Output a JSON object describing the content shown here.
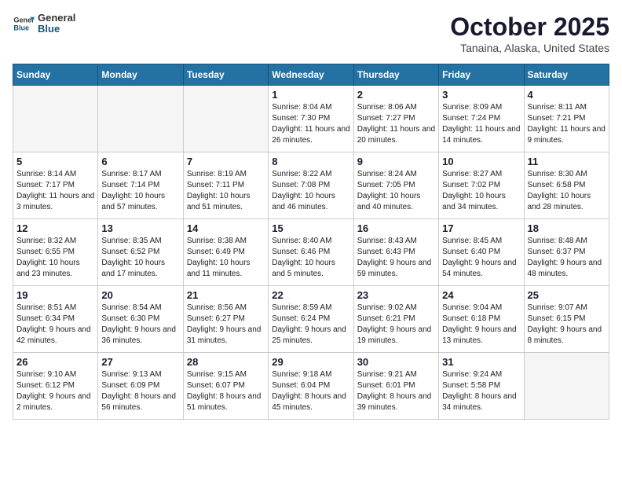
{
  "header": {
    "logo": {
      "general": "General",
      "blue": "Blue"
    },
    "title": "October 2025",
    "location": "Tanaina, Alaska, United States"
  },
  "weekdays": [
    "Sunday",
    "Monday",
    "Tuesday",
    "Wednesday",
    "Thursday",
    "Friday",
    "Saturday"
  ],
  "weeks": [
    [
      {
        "day": "",
        "empty": true
      },
      {
        "day": "",
        "empty": true
      },
      {
        "day": "",
        "empty": true
      },
      {
        "day": "1",
        "sunrise": "Sunrise: 8:04 AM",
        "sunset": "Sunset: 7:30 PM",
        "daylight": "Daylight: 11 hours and 26 minutes."
      },
      {
        "day": "2",
        "sunrise": "Sunrise: 8:06 AM",
        "sunset": "Sunset: 7:27 PM",
        "daylight": "Daylight: 11 hours and 20 minutes."
      },
      {
        "day": "3",
        "sunrise": "Sunrise: 8:09 AM",
        "sunset": "Sunset: 7:24 PM",
        "daylight": "Daylight: 11 hours and 14 minutes."
      },
      {
        "day": "4",
        "sunrise": "Sunrise: 8:11 AM",
        "sunset": "Sunset: 7:21 PM",
        "daylight": "Daylight: 11 hours and 9 minutes."
      }
    ],
    [
      {
        "day": "5",
        "sunrise": "Sunrise: 8:14 AM",
        "sunset": "Sunset: 7:17 PM",
        "daylight": "Daylight: 11 hours and 3 minutes."
      },
      {
        "day": "6",
        "sunrise": "Sunrise: 8:17 AM",
        "sunset": "Sunset: 7:14 PM",
        "daylight": "Daylight: 10 hours and 57 minutes."
      },
      {
        "day": "7",
        "sunrise": "Sunrise: 8:19 AM",
        "sunset": "Sunset: 7:11 PM",
        "daylight": "Daylight: 10 hours and 51 minutes."
      },
      {
        "day": "8",
        "sunrise": "Sunrise: 8:22 AM",
        "sunset": "Sunset: 7:08 PM",
        "daylight": "Daylight: 10 hours and 46 minutes."
      },
      {
        "day": "9",
        "sunrise": "Sunrise: 8:24 AM",
        "sunset": "Sunset: 7:05 PM",
        "daylight": "Daylight: 10 hours and 40 minutes."
      },
      {
        "day": "10",
        "sunrise": "Sunrise: 8:27 AM",
        "sunset": "Sunset: 7:02 PM",
        "daylight": "Daylight: 10 hours and 34 minutes."
      },
      {
        "day": "11",
        "sunrise": "Sunrise: 8:30 AM",
        "sunset": "Sunset: 6:58 PM",
        "daylight": "Daylight: 10 hours and 28 minutes."
      }
    ],
    [
      {
        "day": "12",
        "sunrise": "Sunrise: 8:32 AM",
        "sunset": "Sunset: 6:55 PM",
        "daylight": "Daylight: 10 hours and 23 minutes."
      },
      {
        "day": "13",
        "sunrise": "Sunrise: 8:35 AM",
        "sunset": "Sunset: 6:52 PM",
        "daylight": "Daylight: 10 hours and 17 minutes."
      },
      {
        "day": "14",
        "sunrise": "Sunrise: 8:38 AM",
        "sunset": "Sunset: 6:49 PM",
        "daylight": "Daylight: 10 hours and 11 minutes."
      },
      {
        "day": "15",
        "sunrise": "Sunrise: 8:40 AM",
        "sunset": "Sunset: 6:46 PM",
        "daylight": "Daylight: 10 hours and 5 minutes."
      },
      {
        "day": "16",
        "sunrise": "Sunrise: 8:43 AM",
        "sunset": "Sunset: 6:43 PM",
        "daylight": "Daylight: 9 hours and 59 minutes."
      },
      {
        "day": "17",
        "sunrise": "Sunrise: 8:45 AM",
        "sunset": "Sunset: 6:40 PM",
        "daylight": "Daylight: 9 hours and 54 minutes."
      },
      {
        "day": "18",
        "sunrise": "Sunrise: 8:48 AM",
        "sunset": "Sunset: 6:37 PM",
        "daylight": "Daylight: 9 hours and 48 minutes."
      }
    ],
    [
      {
        "day": "19",
        "sunrise": "Sunrise: 8:51 AM",
        "sunset": "Sunset: 6:34 PM",
        "daylight": "Daylight: 9 hours and 42 minutes."
      },
      {
        "day": "20",
        "sunrise": "Sunrise: 8:54 AM",
        "sunset": "Sunset: 6:30 PM",
        "daylight": "Daylight: 9 hours and 36 minutes."
      },
      {
        "day": "21",
        "sunrise": "Sunrise: 8:56 AM",
        "sunset": "Sunset: 6:27 PM",
        "daylight": "Daylight: 9 hours and 31 minutes."
      },
      {
        "day": "22",
        "sunrise": "Sunrise: 8:59 AM",
        "sunset": "Sunset: 6:24 PM",
        "daylight": "Daylight: 9 hours and 25 minutes."
      },
      {
        "day": "23",
        "sunrise": "Sunrise: 9:02 AM",
        "sunset": "Sunset: 6:21 PM",
        "daylight": "Daylight: 9 hours and 19 minutes."
      },
      {
        "day": "24",
        "sunrise": "Sunrise: 9:04 AM",
        "sunset": "Sunset: 6:18 PM",
        "daylight": "Daylight: 9 hours and 13 minutes."
      },
      {
        "day": "25",
        "sunrise": "Sunrise: 9:07 AM",
        "sunset": "Sunset: 6:15 PM",
        "daylight": "Daylight: 9 hours and 8 minutes."
      }
    ],
    [
      {
        "day": "26",
        "sunrise": "Sunrise: 9:10 AM",
        "sunset": "Sunset: 6:12 PM",
        "daylight": "Daylight: 9 hours and 2 minutes."
      },
      {
        "day": "27",
        "sunrise": "Sunrise: 9:13 AM",
        "sunset": "Sunset: 6:09 PM",
        "daylight": "Daylight: 8 hours and 56 minutes."
      },
      {
        "day": "28",
        "sunrise": "Sunrise: 9:15 AM",
        "sunset": "Sunset: 6:07 PM",
        "daylight": "Daylight: 8 hours and 51 minutes."
      },
      {
        "day": "29",
        "sunrise": "Sunrise: 9:18 AM",
        "sunset": "Sunset: 6:04 PM",
        "daylight": "Daylight: 8 hours and 45 minutes."
      },
      {
        "day": "30",
        "sunrise": "Sunrise: 9:21 AM",
        "sunset": "Sunset: 6:01 PM",
        "daylight": "Daylight: 8 hours and 39 minutes."
      },
      {
        "day": "31",
        "sunrise": "Sunrise: 9:24 AM",
        "sunset": "Sunset: 5:58 PM",
        "daylight": "Daylight: 8 hours and 34 minutes."
      },
      {
        "day": "",
        "empty": true
      }
    ]
  ]
}
